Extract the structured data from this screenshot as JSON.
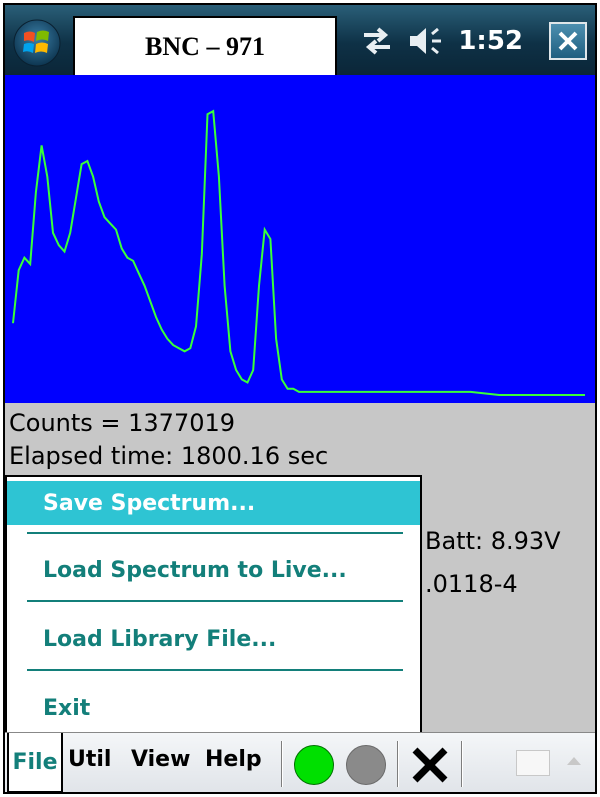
{
  "window": {
    "title": "BNC – 971",
    "clock": "1:52"
  },
  "icons": {
    "start": "windows-start-icon",
    "connectivity": "connectivity-icon",
    "volume": "volume-icon",
    "close": "close-icon",
    "keyboard": "keyboard-icon"
  },
  "colors": {
    "plot_background": "#0000ff",
    "trace": "#39ff39",
    "menu_text": "#137f7a",
    "menu_selected": "#2ec4d3",
    "status_green": "#00e000",
    "status_gray": "#8a8a8a"
  },
  "chart_data": {
    "type": "line",
    "title": "",
    "xlabel": "",
    "ylabel": "",
    "grid": false,
    "series": [
      {
        "values": [
          [
            0,
            23
          ],
          [
            1,
            40
          ],
          [
            2,
            44
          ],
          [
            3,
            42
          ],
          [
            4,
            65
          ],
          [
            5,
            80
          ],
          [
            6,
            70
          ],
          [
            7,
            52
          ],
          [
            8,
            48
          ],
          [
            9,
            46
          ],
          [
            10,
            52
          ],
          [
            11,
            63
          ],
          [
            12,
            74
          ],
          [
            13,
            75
          ],
          [
            14,
            70
          ],
          [
            15,
            62
          ],
          [
            16,
            57
          ],
          [
            17,
            55
          ],
          [
            18,
            53
          ],
          [
            19,
            47
          ],
          [
            20,
            44
          ],
          [
            21,
            43
          ],
          [
            22,
            39
          ],
          [
            23,
            35
          ],
          [
            24,
            30
          ],
          [
            25,
            25
          ],
          [
            26,
            21
          ],
          [
            27,
            18
          ],
          [
            28,
            16
          ],
          [
            29,
            15
          ],
          [
            30,
            14
          ],
          [
            31,
            15
          ],
          [
            32,
            22
          ],
          [
            33,
            45
          ],
          [
            34,
            90
          ],
          [
            35,
            91
          ],
          [
            36,
            70
          ],
          [
            37,
            35
          ],
          [
            38,
            14
          ],
          [
            39,
            8
          ],
          [
            40,
            5
          ],
          [
            41,
            4
          ],
          [
            42,
            8
          ],
          [
            43,
            35
          ],
          [
            44,
            53
          ],
          [
            45,
            50
          ],
          [
            46,
            18
          ],
          [
            47,
            5
          ],
          [
            48,
            2
          ],
          [
            49,
            2
          ],
          [
            50,
            1
          ],
          [
            51,
            1
          ],
          [
            52,
            1
          ],
          [
            55,
            1
          ],
          [
            60,
            1
          ],
          [
            65,
            1
          ],
          [
            70,
            1
          ],
          [
            75,
            1
          ],
          [
            80,
            1
          ],
          [
            85,
            0
          ],
          [
            90,
            0
          ],
          [
            95,
            0
          ],
          [
            100,
            0
          ]
        ]
      }
    ]
  },
  "status": {
    "counts": "Counts = 1377019",
    "elapsed": "Elapsed time: 1800.16 sec",
    "battery": "Batt: 8.93V",
    "serial": ".0118-4"
  },
  "file_menu": {
    "items": [
      "Save Spectrum...",
      "Load Spectrum to Live...",
      "Load Library File...",
      "Exit"
    ],
    "selected_index": 0
  },
  "menubar": {
    "file": "File",
    "util": "Util",
    "view": "View",
    "help": "Help"
  },
  "toolbar": {
    "start_icon": "start-acquisition-icon",
    "stop_icon": "stop-acquisition-icon",
    "close_icon": "close-x-icon"
  }
}
